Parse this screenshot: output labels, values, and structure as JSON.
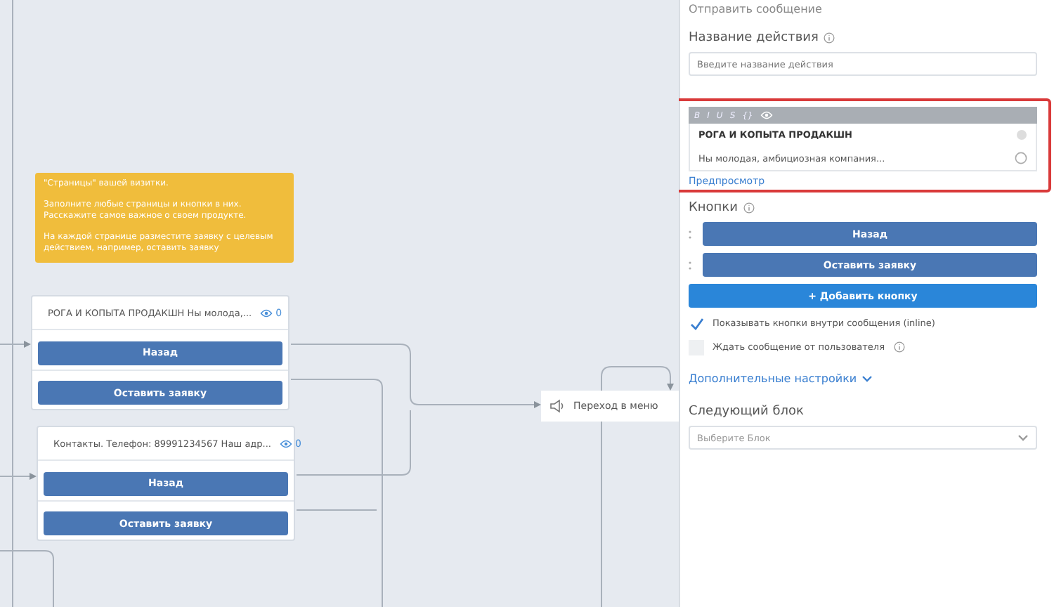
{
  "canvas": {
    "note": {
      "paragraphs": [
        "\"Страницы\" вашей визитки.",
        "Заполните любые страницы и кнопки в них. Расскажите самое важное о своем продукте.",
        "На каждой странице разместите заявку с целевым действием, например, оставить заявку"
      ]
    },
    "message_nodes": [
      {
        "title": "РОГА И КОПЫТА ПРОДАКШН Ны молода,...",
        "views": "0",
        "buttons": [
          "Назад",
          "Оставить заявку"
        ]
      },
      {
        "title": "Контакты. Телефон: 89991234567 Наш адр...",
        "views": "0",
        "buttons": [
          "Назад",
          "Оставить заявку"
        ]
      }
    ],
    "menu_node": {
      "label": "Переход в меню"
    }
  },
  "panel": {
    "title": "Отправить сообщение",
    "action_name": {
      "label": "Название действия",
      "placeholder": "Введите название действия"
    },
    "editor": {
      "toolbar": [
        "B",
        "I",
        "U",
        "S",
        "{}"
      ],
      "heading": "РОГА И КОПЫТА ПРОДАКШН",
      "body": "Ны молодая, амбициозная компания...",
      "preview_link": "Предпросмотр"
    },
    "buttons_label": "Кнопки",
    "buttons": [
      "Назад",
      "Оставить заявку"
    ],
    "add_button": "+ Добавить кнопку",
    "options": [
      {
        "label": "Показывать кнопки внутри сообщения (inline)",
        "checked": true,
        "info": false
      },
      {
        "label": "Ждать сообщение от пользователя",
        "checked": false,
        "info": true
      }
    ],
    "advanced_link": "Дополнительные настройки",
    "next_block": {
      "label": "Следующий блок",
      "placeholder": "Выберите Блок"
    }
  }
}
